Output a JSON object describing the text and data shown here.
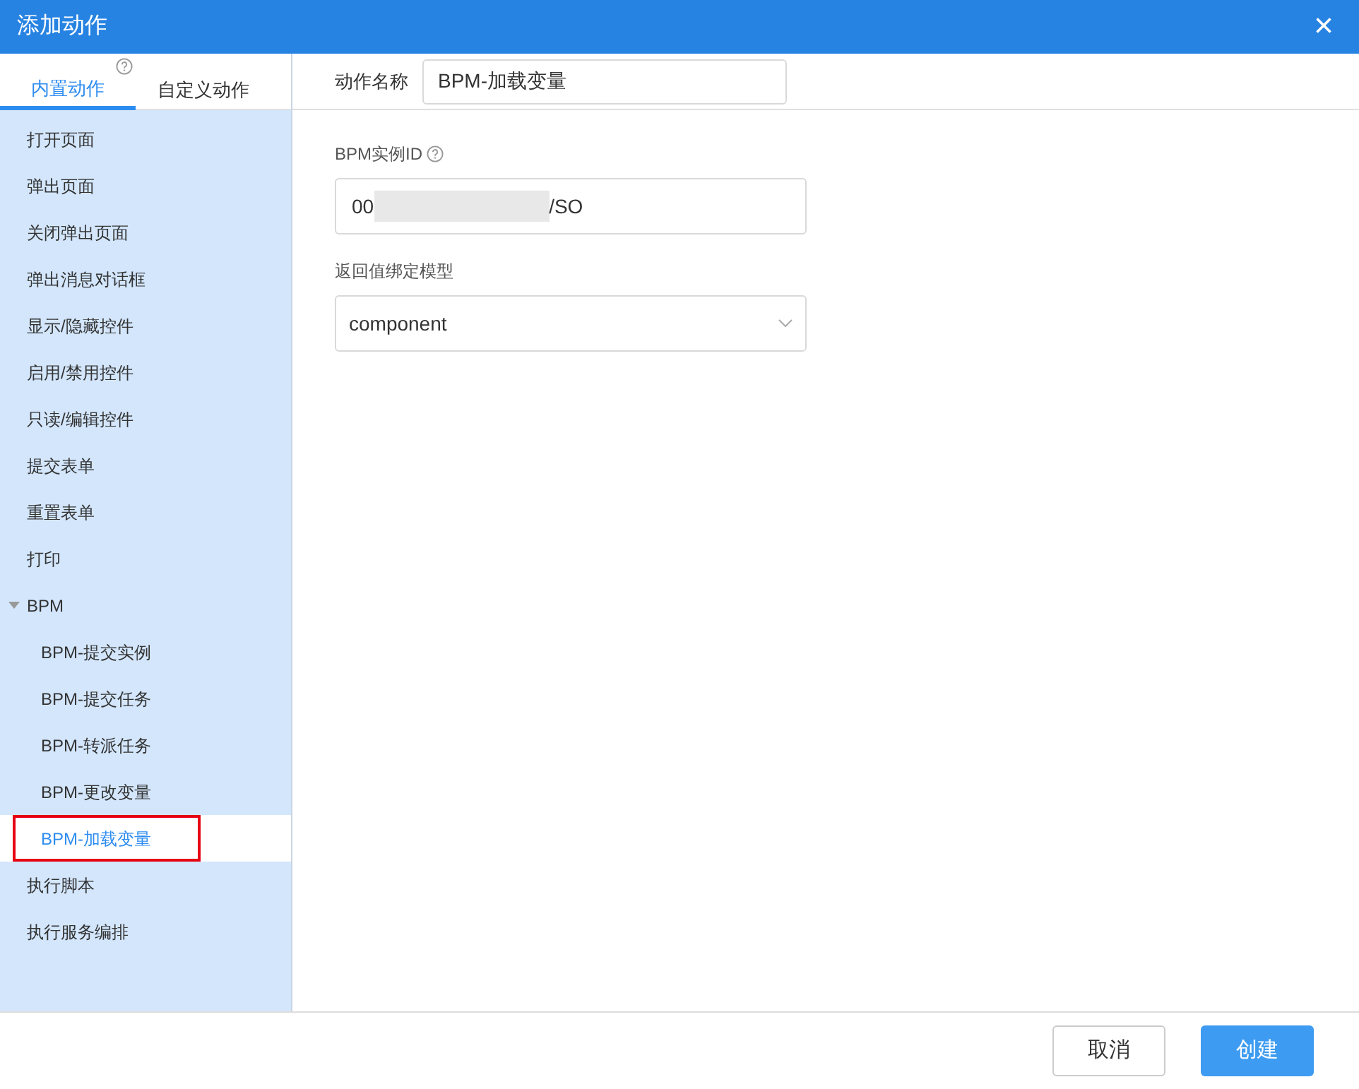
{
  "window": {
    "title": "添加动作",
    "close": "×"
  },
  "tabs": [
    {
      "label": "内置动作",
      "selected": true,
      "help": true
    },
    {
      "label": "自定义动作",
      "selected": false,
      "help": false
    }
  ],
  "actions": [
    {
      "label": "打开页面",
      "selected": false
    },
    {
      "label": "弹出页面",
      "selected": false
    },
    {
      "label": "关闭弹出页面",
      "selected": false
    },
    {
      "label": "弹出消息对话框",
      "selected": false
    },
    {
      "label": "显示/隐藏控件",
      "selected": false
    },
    {
      "label": "启用/禁用控件",
      "selected": false
    },
    {
      "label": "只读/编辑控件",
      "selected": false
    },
    {
      "label": "提交表单",
      "selected": false
    },
    {
      "label": "重置表单",
      "selected": false
    },
    {
      "label": "打印",
      "selected": false
    },
    {
      "label": "BPM",
      "selected": false,
      "expanded": true,
      "children": [
        {
          "label": "BPM-提交实例",
          "selected": false,
          "highlighted": false
        },
        {
          "label": "BPM-提交任务",
          "selected": false,
          "highlighted": false
        },
        {
          "label": "BPM-转派任务",
          "selected": false,
          "highlighted": false
        },
        {
          "label": "BPM-更改变量",
          "selected": false,
          "highlighted": false
        },
        {
          "label": "BPM-加载变量",
          "selected": true,
          "highlighted": true
        }
      ]
    },
    {
      "label": "执行脚本",
      "selected": false
    },
    {
      "label": "执行服务编排",
      "selected": false
    }
  ],
  "action_name": {
    "label": "动作名称",
    "value": "BPM-加载变量"
  },
  "fields": [
    {
      "kind": "text",
      "label": "BPM实例ID",
      "help": true,
      "value_start": "00",
      "redacted": true,
      "value_end": "/SO"
    },
    {
      "kind": "select",
      "label": "返回值绑定模型",
      "value": "component"
    }
  ],
  "buttons": [
    {
      "label": "取消",
      "primary": false
    },
    {
      "label": "创建",
      "primary": true
    }
  ]
}
